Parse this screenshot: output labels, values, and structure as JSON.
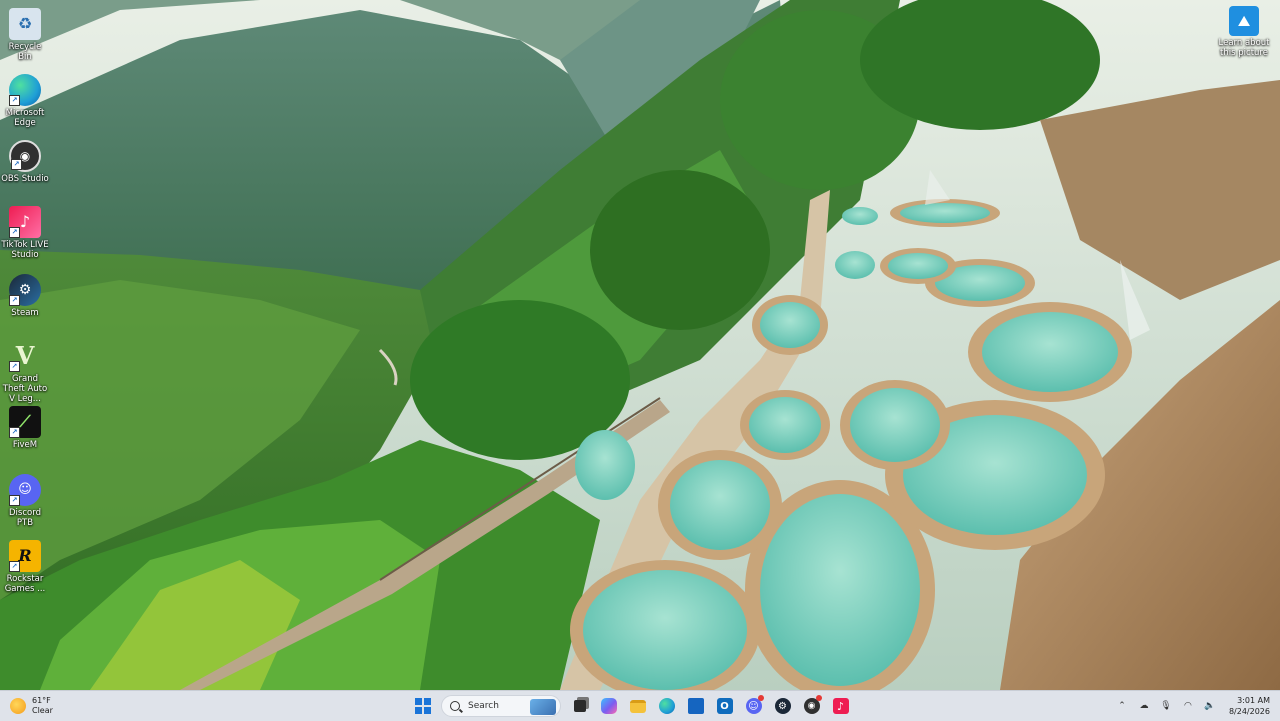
{
  "desktop": {
    "icons": [
      {
        "label": "Recycle Bin",
        "icon": "recycle-bin-icon",
        "color": "#d8e4ee"
      },
      {
        "label": "Microsoft Edge",
        "icon": "edge-icon",
        "color": "#1f9fd6"
      },
      {
        "label": "OBS Studio",
        "icon": "obs-icon",
        "color": "#303030"
      },
      {
        "label": "TikTok LIVE Studio",
        "icon": "tiktok-live-icon",
        "color": "#ee1d52"
      },
      {
        "label": "Steam",
        "icon": "steam-icon",
        "color": "#1b2838"
      },
      {
        "label": "Grand Theft Auto V Leg...",
        "icon": "gta-icon",
        "color": "#5a8c3c"
      },
      {
        "label": "FiveM",
        "icon": "fivem-icon",
        "color": "#111111"
      },
      {
        "label": "Discord PTB",
        "icon": "discord-icon",
        "color": "#5865f2"
      },
      {
        "label": "Rockstar Games ...",
        "icon": "rockstar-icon",
        "color": "#f5b400"
      }
    ],
    "learn": {
      "label": "Learn about this picture",
      "icon": "learn-about-picture-icon"
    }
  },
  "taskbar": {
    "weather": {
      "temp": "61°F",
      "condition": "Clear",
      "icon": "sun-icon"
    },
    "search_placeholder": "Search",
    "apps": [
      {
        "name": "task-view",
        "color": "#2b2b2b"
      },
      {
        "name": "copilot",
        "color": "#7b5cf0"
      },
      {
        "name": "file-explorer",
        "color": "#f4c23b"
      },
      {
        "name": "edge",
        "color": "#1f9fd6"
      },
      {
        "name": "microsoft-store",
        "color": "#1565c0"
      },
      {
        "name": "outlook",
        "color": "#0f6cbd"
      },
      {
        "name": "discord",
        "color": "#5865f2"
      },
      {
        "name": "steam",
        "color": "#1b2838"
      },
      {
        "name": "obs",
        "color": "#303030"
      },
      {
        "name": "tiktok",
        "color": "#ee1d52"
      }
    ],
    "clock": {
      "time": "3:01 AM",
      "date": "8/24/2026"
    }
  }
}
